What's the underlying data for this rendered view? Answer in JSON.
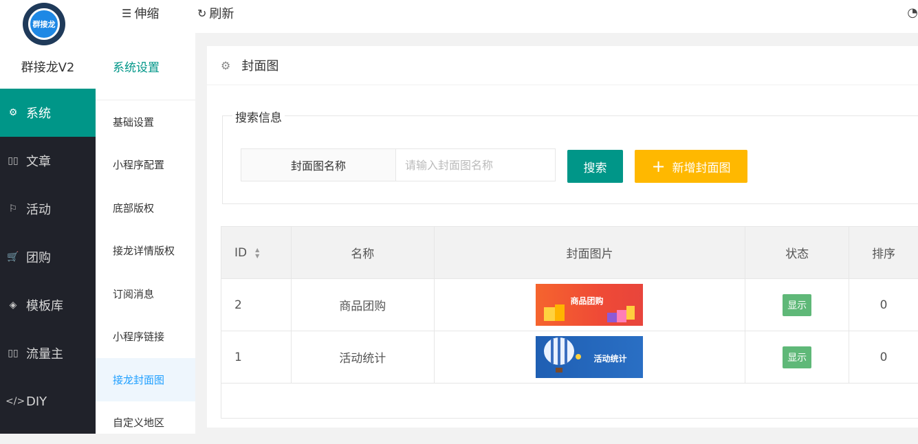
{
  "app": {
    "logo_text": "群接龙",
    "title": "群接龙V2"
  },
  "sidebar": {
    "items": [
      {
        "label": "系统",
        "icon": "gear-icon",
        "active": true
      },
      {
        "label": "文章",
        "icon": "book-icon"
      },
      {
        "label": "活动",
        "icon": "flag-icon"
      },
      {
        "label": "团购",
        "icon": "cart-icon"
      },
      {
        "label": "模板库",
        "icon": "layers-icon"
      },
      {
        "label": "流量主",
        "icon": "columns-icon"
      },
      {
        "label": "DIY",
        "icon": "code-icon"
      }
    ]
  },
  "topbar": {
    "collapse_label": "伸缩",
    "refresh_label": "刷新"
  },
  "subnav": {
    "title": "系统设置",
    "items": [
      {
        "label": "基础设置"
      },
      {
        "label": "小程序配置"
      },
      {
        "label": "底部版权"
      },
      {
        "label": "接龙详情版权"
      },
      {
        "label": "订阅消息"
      },
      {
        "label": "小程序链接"
      },
      {
        "label": "接龙封面图",
        "active": true
      },
      {
        "label": "自定义地区"
      }
    ]
  },
  "main": {
    "header_title": "封面图",
    "search": {
      "legend": "搜索信息",
      "field_label": "封面图名称",
      "placeholder": "请输入封面图名称",
      "value": "",
      "search_button": "搜索",
      "add_button": "新增封面图"
    },
    "table": {
      "columns": [
        "ID",
        "名称",
        "封面图片",
        "状态",
        "排序"
      ],
      "rows": [
        {
          "id": "2",
          "name": "商品团购",
          "image_text": "商品团购",
          "status": "显示",
          "sort": "0"
        },
        {
          "id": "1",
          "name": "活动统计",
          "image_text": "活动统计",
          "status": "显示",
          "sort": "0"
        }
      ]
    }
  },
  "colors": {
    "primary": "#009688",
    "warn": "#ffb800",
    "success": "#5fb878",
    "sidebar_bg": "#20222a"
  }
}
